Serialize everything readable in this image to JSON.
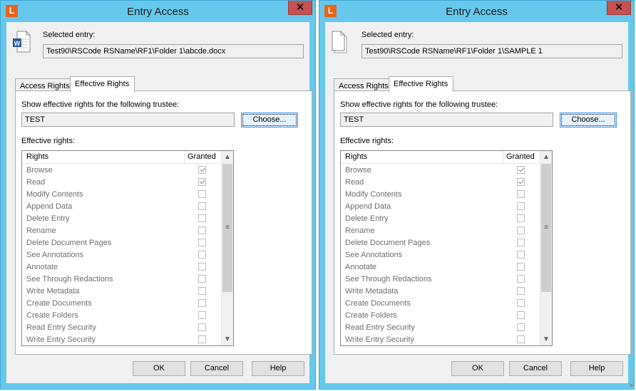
{
  "colors": {
    "frame": "#66c8ec",
    "close": "#c75050",
    "app_icon": "#e9641c",
    "focus": "#3399ff"
  },
  "dialogs": [
    {
      "app_icon_letter": "L",
      "title": "Entry Access",
      "close_glyph": "✕",
      "entry_icon": "word-document-icon",
      "selected_label": "Selected entry:",
      "selected_path": "Test90\\RSCode RSName\\RF1\\Folder 1\\abcde.docx",
      "tabs": [
        "Access Rights",
        "Effective Rights"
      ],
      "trustee_label": "Show effective rights for the following trustee:",
      "trustee_value": "TEST",
      "choose_label": "Choose...",
      "rights_label": "Effective rights:",
      "col_rights": "Rights",
      "col_granted": "Granted",
      "rights": [
        {
          "name": "Browse",
          "granted": true
        },
        {
          "name": "Read",
          "granted": true
        },
        {
          "name": "Modify Contents",
          "granted": false
        },
        {
          "name": "Append Data",
          "granted": false
        },
        {
          "name": "Delete Entry",
          "granted": false
        },
        {
          "name": "Rename",
          "granted": false
        },
        {
          "name": "Delete Document Pages",
          "granted": false
        },
        {
          "name": "See Annotations",
          "granted": false
        },
        {
          "name": "Annotate",
          "granted": false
        },
        {
          "name": "See Through Redactions",
          "granted": false
        },
        {
          "name": "Write Metadata",
          "granted": false
        },
        {
          "name": "Create Documents",
          "granted": false
        },
        {
          "name": "Create Folders",
          "granted": false
        },
        {
          "name": "Read Entry Security",
          "granted": false
        },
        {
          "name": "Write Entry Security",
          "granted": false
        }
      ],
      "ok_label": "OK",
      "cancel_label": "Cancel",
      "help_label": "Help"
    },
    {
      "app_icon_letter": "L",
      "title": "Entry Access",
      "close_glyph": "✕",
      "entry_icon": "generic-document-icon",
      "selected_label": "Selected entry:",
      "selected_path": "Test90\\RSCode RSName\\RF1\\Folder 1\\SAMPLE 1",
      "tabs": [
        "Access Rights",
        "Effective Rights"
      ],
      "trustee_label": "Show effective rights for the following trustee:",
      "trustee_value": "TEST",
      "choose_label": "Choose...",
      "rights_label": "Effective rights:",
      "col_rights": "Rights",
      "col_granted": "Granted",
      "rights": [
        {
          "name": "Browse",
          "granted": true
        },
        {
          "name": "Read",
          "granted": true
        },
        {
          "name": "Modify Contents",
          "granted": false
        },
        {
          "name": "Append Data",
          "granted": false
        },
        {
          "name": "Delete Entry",
          "granted": false
        },
        {
          "name": "Rename",
          "granted": false
        },
        {
          "name": "Delete Document Pages",
          "granted": false
        },
        {
          "name": "See Annotations",
          "granted": false
        },
        {
          "name": "Annotate",
          "granted": false
        },
        {
          "name": "See Through Redactions",
          "granted": false
        },
        {
          "name": "Write Metadata",
          "granted": false
        },
        {
          "name": "Create Documents",
          "granted": false
        },
        {
          "name": "Create Folders",
          "granted": false
        },
        {
          "name": "Read Entry Security",
          "granted": false
        },
        {
          "name": "Write Entry Security",
          "granted": false
        }
      ],
      "ok_label": "OK",
      "cancel_label": "Cancel",
      "help_label": "Help"
    }
  ]
}
